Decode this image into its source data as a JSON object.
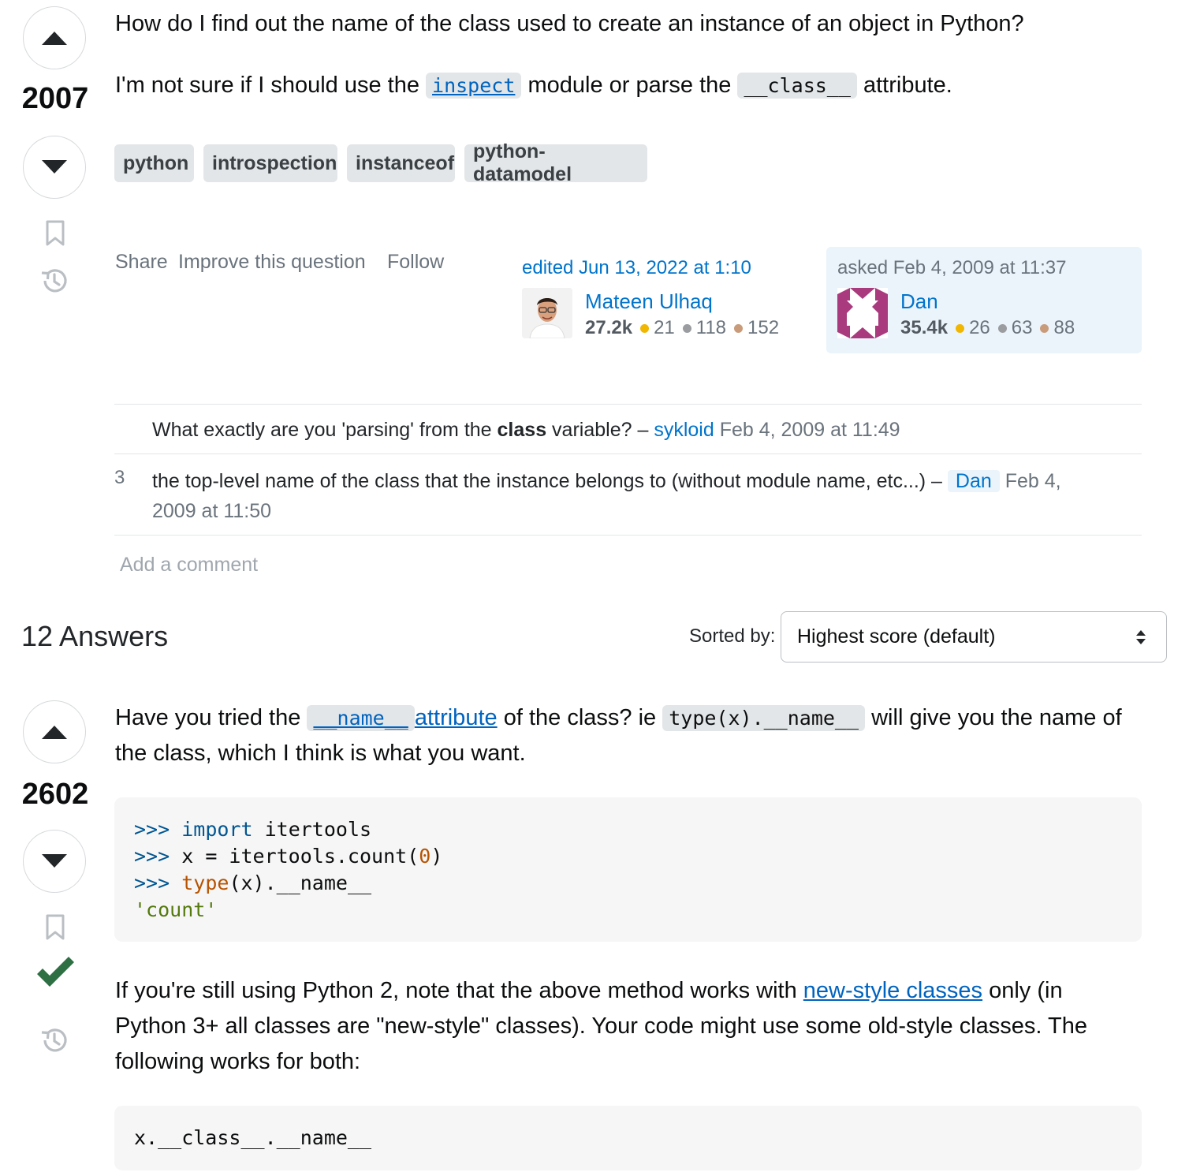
{
  "question": {
    "title_line": "How do I find out the name of the class used to create an instance of an object in Python?",
    "body_parts": {
      "before": "I'm not sure if I should use the",
      "code1": "inspect",
      "middle": "module or parse the",
      "code2": "__class__",
      "after": "attribute."
    },
    "score": "2007",
    "tags": [
      "python",
      "introspection",
      "instanceof",
      "python-datamodel"
    ],
    "menu": {
      "share": "Share",
      "improve": "Improve this question",
      "follow": "Follow"
    },
    "editor": {
      "action": "edited Jun 13, 2022 at 1:10",
      "name": "Mateen Ulhaq",
      "rep": "27.2k",
      "gold": "21",
      "silver": "118",
      "bronze": "152"
    },
    "owner": {
      "action": "asked Feb 4, 2009 at 11:37",
      "name": "Dan",
      "rep": "35.4k",
      "gold": "26",
      "silver": "63",
      "bronze": "88"
    }
  },
  "comments": [
    {
      "score": "",
      "text_before": "What exactly are you 'parsing' from the",
      "bold": "class",
      "text_after": "variable? –",
      "user": "sykloid",
      "date": "Feb 4, 2009 at 11:49"
    },
    {
      "score": "3",
      "text": "the top-level name of the class that the instance belongs to (without module name, etc...) –",
      "user": "Dan",
      "date_part1": "Feb 4,",
      "date_part2": "2009 at 11:50"
    }
  ],
  "add_comment": "Add a comment",
  "answers_header": {
    "count_label": "12 Answers",
    "sorted_by": "Sorted by:",
    "sort_value": "Highest score (default)"
  },
  "answer": {
    "score": "2602",
    "p1": {
      "before": "Have you tried the",
      "code_link": "__name__",
      "link_text": "attribute",
      "middle": "of the class? ie",
      "code": "type(x).__name__",
      "after": "will give you the name of",
      "line2": "the class, which I think is what you want."
    },
    "code_block_1": {
      "l1_prompt": ">>>",
      "l1_kw": "import",
      "l1_rest": "itertools",
      "l2_prompt": ">>>",
      "l2_a": "x = itertools.count(",
      "l2_num": "0",
      "l2_b": ")",
      "l3_prompt": ">>>",
      "l3_bi": "type",
      "l3_rest": "(x).__name__",
      "l4_str": "'count'"
    },
    "p2": {
      "before": "If you're still using Python 2, note that the above method works with",
      "link": "new-style classes",
      "after": "only (in",
      "line2": "Python 3+ all classes are \"new-style\" classes). Your code might use some old-style classes. The",
      "line3": "following works for both:"
    },
    "code_block_2": "x.__class__.__name__"
  },
  "colors": {
    "accepted": "#2f6f44",
    "link": "#0074cc",
    "gold": "#f1b600",
    "silver": "#9a9c9f",
    "bronze": "#ca9b7a",
    "owner_bg": "#ebf4fb"
  }
}
